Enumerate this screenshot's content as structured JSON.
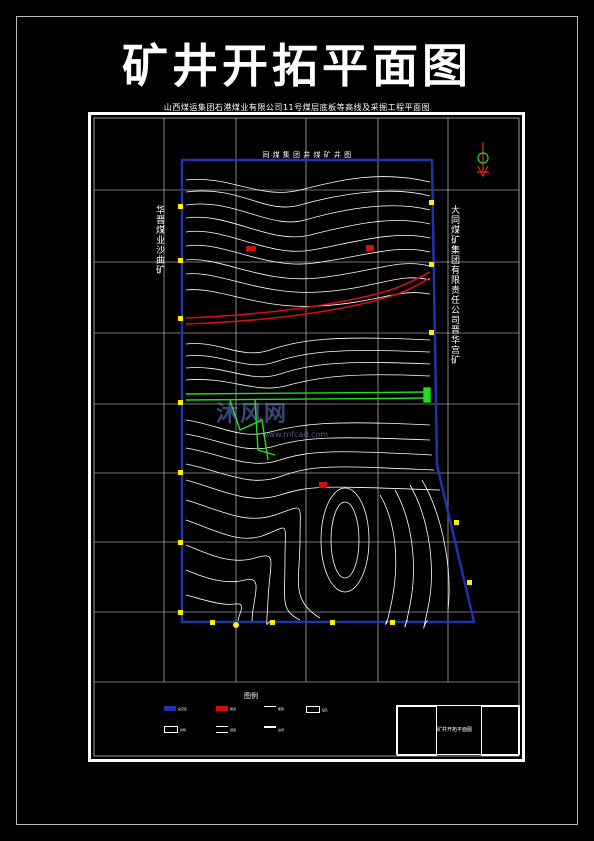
{
  "title": "矿井开拓平面图",
  "subtitle": "山西煤运集团石港煤业有限公司11号煤层底板等高线及采掘工程平面图",
  "map_header": "同 煤 集 团 井 煤 矿 井 图",
  "left_side_label": "华晋煤业沙曲矿",
  "right_side_label": "大同煤矿集团有限责任公司晋华宫矿",
  "watermark": "沐风网",
  "watermark_url": "www.mfcad.com",
  "legend": {
    "title": "图例",
    "items": [
      "采空区",
      "巷道",
      "断层",
      "钻孔",
      "井筒",
      "煤层",
      "边界"
    ]
  },
  "title_block": {
    "drawing_name": "矿井开拓平面图"
  },
  "colors": {
    "boundary": "#2233aa",
    "contour": "#ffffff",
    "roadway": "#d01010",
    "workings": "#22dd22",
    "point_marker": "#ffee00",
    "north_arrow": "#ee2222"
  }
}
